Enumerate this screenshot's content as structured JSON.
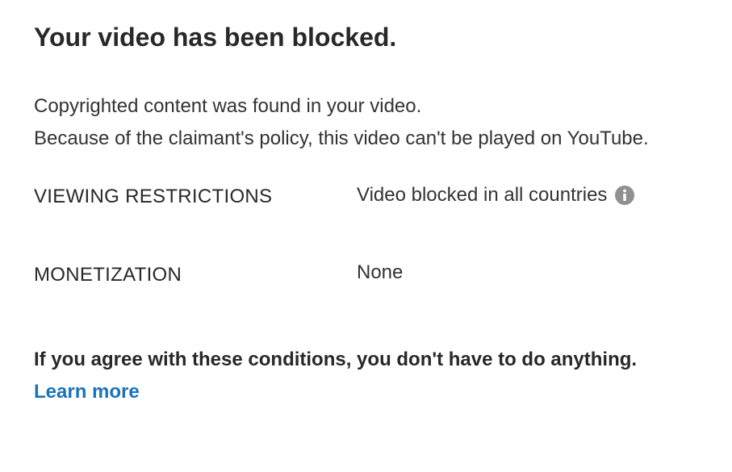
{
  "dialog": {
    "title": "Your video has been blocked.",
    "description_line1": "Copyrighted content was found in your video.",
    "description_line2": "Because of the claimant's policy, this video can't be played on YouTube."
  },
  "restrictions": {
    "viewing_label": "VIEWING RESTRICTIONS",
    "viewing_value": "Video blocked in all countries",
    "viewing_icon": "info-icon",
    "monetization_label": "MONETIZATION",
    "monetization_value": "None"
  },
  "footer": {
    "notice": "If you agree with these conditions, you don't have to do anything.",
    "learn_more": "Learn more"
  },
  "colors": {
    "text": "#282828",
    "link": "#1a73b8",
    "icon": "#909090"
  }
}
